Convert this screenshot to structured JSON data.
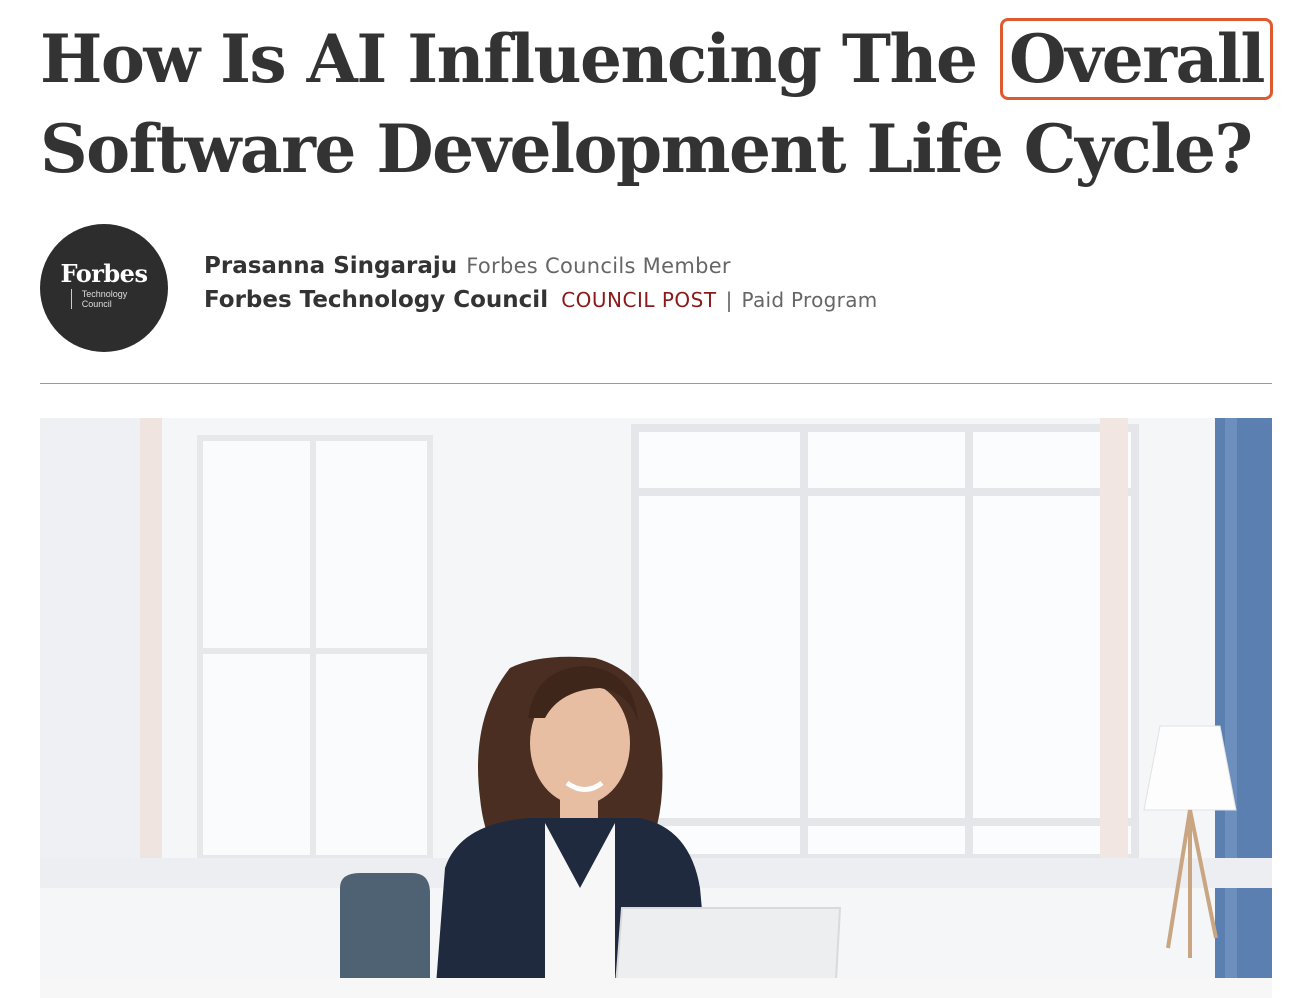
{
  "article": {
    "headline_line1": "How Is AI Influencing The",
    "headline_highlight": "Overall",
    "headline_line2": "Software Development Life Cycle?"
  },
  "logo": {
    "brand": "Forbes",
    "sub_line1": "Technology",
    "sub_line2": "Council"
  },
  "byline": {
    "author": "Prasanna Singaraju",
    "member_label": "Forbes Councils Member",
    "council": "Forbes Technology Council",
    "post_type": "COUNCIL POST",
    "separator": "|",
    "program": "Paid Program"
  },
  "colors": {
    "highlight_border": "#e05a2f",
    "post_type": "#8b1a1a",
    "text": "#333333",
    "muted": "#666666"
  },
  "hero_image": {
    "icon": "photo-woman-at-laptop-in-bright-office"
  }
}
